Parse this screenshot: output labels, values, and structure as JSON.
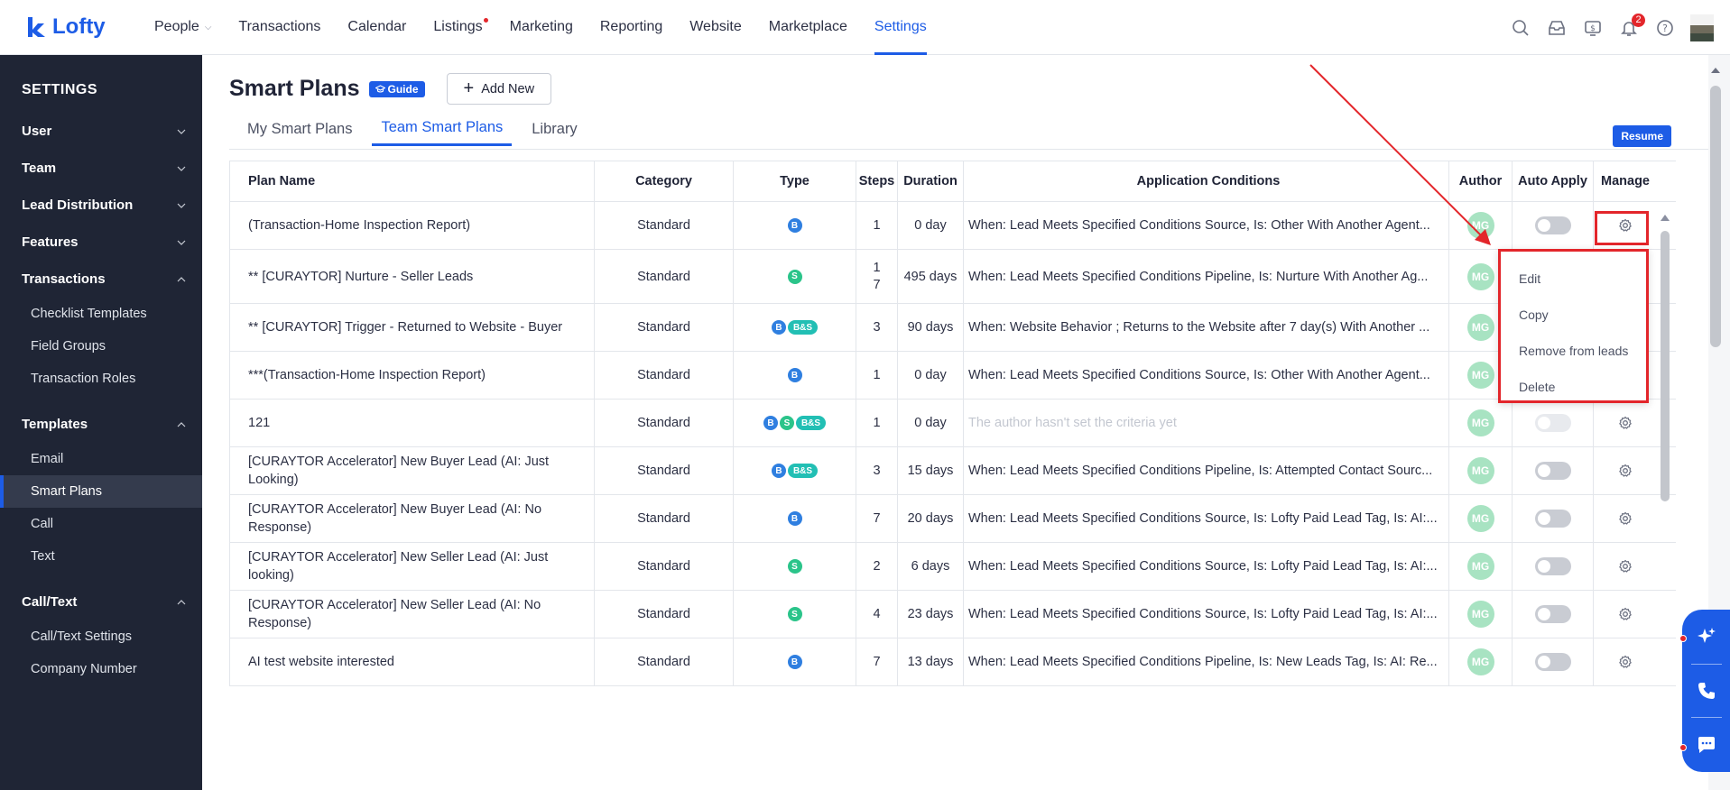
{
  "brand": {
    "name": "Lofty",
    "color": "#1d5ce6"
  },
  "nav": {
    "items": [
      {
        "label": "People",
        "caret": true
      },
      {
        "label": "Transactions"
      },
      {
        "label": "Calendar"
      },
      {
        "label": "Listings",
        "dot": true
      },
      {
        "label": "Marketing"
      },
      {
        "label": "Reporting"
      },
      {
        "label": "Website"
      },
      {
        "label": "Marketplace"
      },
      {
        "label": "Settings",
        "active": true
      }
    ],
    "notification_count": "2"
  },
  "sidebar": {
    "title": "SETTINGS",
    "groups": [
      {
        "label": "User",
        "expanded": false,
        "items": []
      },
      {
        "label": "Team",
        "expanded": false,
        "items": []
      },
      {
        "label": "Lead Distribution",
        "expanded": false,
        "items": []
      },
      {
        "label": "Features",
        "expanded": false,
        "items": []
      },
      {
        "label": "Transactions",
        "expanded": true,
        "items": [
          "Checklist Templates",
          "Field Groups",
          "Transaction Roles"
        ]
      },
      {
        "label": "Templates",
        "expanded": true,
        "items": [
          "Email",
          "Smart Plans",
          "Call",
          "Text"
        ]
      },
      {
        "label": "Call/Text",
        "expanded": true,
        "items": [
          "Call/Text Settings",
          "Company Number"
        ]
      }
    ],
    "active_item": "Smart Plans"
  },
  "page": {
    "title": "Smart Plans",
    "guide_label": "Guide",
    "add_new_label": "Add New",
    "resume_label": "Resume",
    "tabs": [
      {
        "label": "My Smart Plans",
        "active": false
      },
      {
        "label": "Team Smart Plans",
        "active": true
      },
      {
        "label": "Library",
        "active": false
      }
    ]
  },
  "table": {
    "headers": {
      "name": "Plan Name",
      "category": "Category",
      "type": "Type",
      "steps": "Steps",
      "duration": "Duration",
      "conditions": "Application Conditions",
      "author": "Author",
      "auto_apply": "Auto Apply",
      "manage": "Manage"
    },
    "rows": [
      {
        "name": "(Transaction-Home Inspection Report)",
        "category": "Standard",
        "types": [
          "B"
        ],
        "steps": "1",
        "duration": "0 day",
        "conditions": "When: Lead Meets Specified Conditions Source, Is: Other With Another Agent...",
        "author": "MG",
        "auto_apply": "off",
        "height": 53
      },
      {
        "name": "** [CURAYTOR] Nurture - Seller Leads",
        "category": "Standard",
        "types": [
          "S"
        ],
        "steps": "1 7",
        "duration": "495 days",
        "conditions": "When: Lead Meets Specified Conditions Pipeline, Is: Nurture With Another Ag...",
        "author": "MG",
        "auto_apply": "off",
        "height": 60
      },
      {
        "name": "** [CURAYTOR] Trigger - Returned to Website - Buyer",
        "category": "Standard",
        "types": [
          "B",
          "B&S"
        ],
        "steps": "3",
        "duration": "90 days",
        "conditions": "When: Website Behavior ; Returns to the Website after 7 day(s) With Another ...",
        "author": "MG",
        "auto_apply": "off",
        "height": 53
      },
      {
        "name": "***(Transaction-Home Inspection Report)",
        "category": "Standard",
        "types": [
          "B"
        ],
        "steps": "1",
        "duration": "0 day",
        "conditions": "When: Lead Meets Specified Conditions Source, Is: Other With Another Agent...",
        "author": "MG",
        "auto_apply": "off",
        "height": 53
      },
      {
        "name": "121",
        "category": "Standard",
        "types": [
          "B",
          "S",
          "B&S"
        ],
        "steps": "1",
        "duration": "0 day",
        "conditions": "The author hasn't set the criteria yet",
        "muted": true,
        "author": "MG",
        "auto_apply": "disabled",
        "height": 53
      },
      {
        "name": "[CURAYTOR Accelerator] New Buyer Lead (AI: Just Looking)",
        "category": "Standard",
        "types": [
          "B",
          "B&S"
        ],
        "steps": "3",
        "duration": "15 days",
        "conditions": "When: Lead Meets Specified Conditions Pipeline, Is: Attempted Contact Sourc...",
        "author": "MG",
        "auto_apply": "off",
        "height": 53
      },
      {
        "name": "[CURAYTOR Accelerator] New Buyer Lead (AI: No Response)",
        "category": "Standard",
        "types": [
          "B"
        ],
        "steps": "7",
        "duration": "20 days",
        "conditions": "When: Lead Meets Specified Conditions Source, Is: Lofty Paid Lead Tag, Is: AI:...",
        "author": "MG",
        "auto_apply": "off",
        "height": 53
      },
      {
        "name": "[CURAYTOR Accelerator] New Seller Lead (AI: Just looking)",
        "category": "Standard",
        "types": [
          "S"
        ],
        "steps": "2",
        "duration": "6 days",
        "conditions": "When: Lead Meets Specified Conditions Source, Is: Lofty Paid Lead Tag, Is: AI:...",
        "author": "MG",
        "auto_apply": "off",
        "height": 53
      },
      {
        "name": "[CURAYTOR Accelerator] New Seller Lead (AI: No Response)",
        "category": "Standard",
        "types": [
          "S"
        ],
        "steps": "4",
        "duration": "23 days",
        "conditions": "When: Lead Meets Specified Conditions Source, Is: Lofty Paid Lead Tag, Is: AI:...",
        "author": "MG",
        "auto_apply": "off",
        "height": 53
      },
      {
        "name": "AI test website interested",
        "category": "Standard",
        "types": [
          "B"
        ],
        "steps": "7",
        "duration": "13 days",
        "conditions": "When: Lead Meets Specified Conditions Pipeline, Is: New Leads Tag, Is: AI: Re...",
        "author": "MG",
        "auto_apply": "off",
        "height": 53
      }
    ]
  },
  "manage_menu": {
    "items": [
      "Edit",
      "Copy",
      "Remove from leads",
      "Delete"
    ]
  },
  "colors": {
    "accent": "#1d5ce6",
    "annotation": "#e3262b",
    "sidebar_bg": "#1f2535"
  }
}
